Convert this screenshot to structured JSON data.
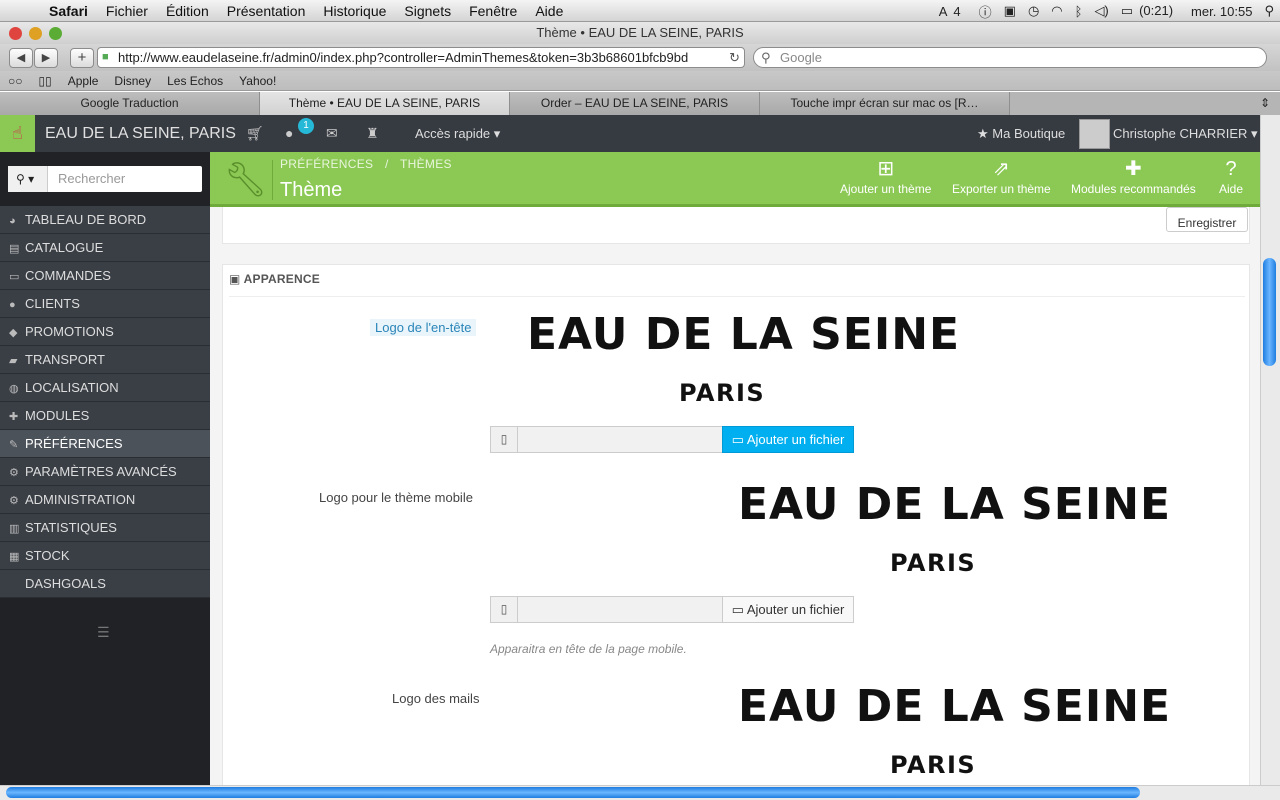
{
  "menubar": {
    "app": "Safari",
    "items": [
      "Fichier",
      "Édition",
      "Présentation",
      "Historique",
      "Signets",
      "Fenêtre",
      "Aide"
    ],
    "status": {
      "adobe": "4",
      "battery": "(0:21)",
      "clock": "mer. 10:55"
    }
  },
  "window": {
    "title": "Thème • EAU DE LA SEINE, PARIS"
  },
  "browser": {
    "url": "http://www.eaudelaseine.fr/admin0/index.php?controller=AdminThemes&token=3b3b68601bfcb9bd",
    "search_placeholder": "Google",
    "bookmarks": [
      "Apple",
      "Disney",
      "Les Echos",
      "Yahoo!"
    ],
    "tabs": [
      {
        "label": "Google Traduction",
        "active": false
      },
      {
        "label": "Thème • EAU DE LA SEINE, PARIS",
        "active": true
      },
      {
        "label": "Order – EAU DE LA SEINE, PARIS",
        "active": false
      },
      {
        "label": "Touche impr écran sur mac os [R…",
        "active": false
      }
    ]
  },
  "header": {
    "shop_name": "EAU DE LA SEINE, PARIS",
    "notif_count": "1",
    "quick_access": "Accès rapide",
    "my_shop": "Ma Boutique",
    "user": "Christophe CHARRIER"
  },
  "sidebar": {
    "search_placeholder": "Rechercher",
    "items": [
      {
        "label": "TABLEAU DE BORD",
        "icon": "dashboard-icon",
        "glyph": "◕"
      },
      {
        "label": "CATALOGUE",
        "icon": "book-icon",
        "glyph": "▤"
      },
      {
        "label": "COMMANDES",
        "icon": "credit-card-icon",
        "glyph": "▭"
      },
      {
        "label": "CLIENTS",
        "icon": "users-icon",
        "glyph": "●"
      },
      {
        "label": "PROMOTIONS",
        "icon": "tags-icon",
        "glyph": "◆"
      },
      {
        "label": "TRANSPORT",
        "icon": "truck-icon",
        "glyph": "▰"
      },
      {
        "label": "LOCALISATION",
        "icon": "globe-icon",
        "glyph": "◍"
      },
      {
        "label": "MODULES",
        "icon": "puzzle-icon",
        "glyph": "✚"
      },
      {
        "label": "PRÉFÉRENCES",
        "icon": "wrench-icon",
        "glyph": "✎"
      },
      {
        "label": "PARAMÈTRES AVANCÉS",
        "icon": "cogs-icon",
        "glyph": "⚙"
      },
      {
        "label": "ADMINISTRATION",
        "icon": "cog-icon",
        "glyph": "⚙"
      },
      {
        "label": "STATISTIQUES",
        "icon": "bar-chart-icon",
        "glyph": "▥"
      },
      {
        "label": "STOCK",
        "icon": "archive-icon",
        "glyph": "▦"
      },
      {
        "label": "DASHGOALS",
        "icon": "",
        "glyph": ""
      }
    ]
  },
  "page": {
    "breadcrumb": [
      "PRÉFÉRENCES",
      "THÈMES"
    ],
    "breadcrumb_sep": "/",
    "title": "Thème",
    "toolbar": [
      "Ajouter un thème",
      "Exporter un thème",
      "Modules recommandés",
      "Aide"
    ]
  },
  "content": {
    "save_label": "Enregistrer",
    "panel_title": "APPARENCE",
    "logo_text": "EAU DE LA SEINE",
    "logo_sub": "PARIS",
    "fields": [
      {
        "label": "Logo de l'en-tête",
        "button": "Ajouter un fichier"
      },
      {
        "label": "Logo pour le thème mobile",
        "button": "Ajouter un fichier",
        "help": "Apparaitra en tête de la page mobile."
      },
      {
        "label": "Logo des mails"
      }
    ]
  }
}
